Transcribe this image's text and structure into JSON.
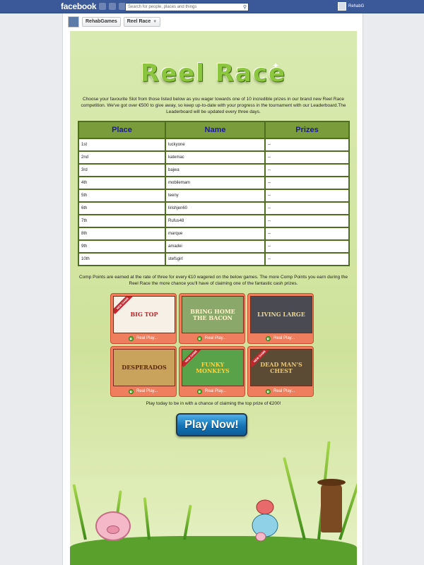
{
  "facebook": {
    "logo": "facebook",
    "search_placeholder": "Search for people, places and things",
    "user_name": "RehabG"
  },
  "breadcrumb": {
    "page": "RehabGames",
    "tab": "Reel Race"
  },
  "app": {
    "logo_text": "Reel Race",
    "intro": "Choose your favourite Slot from those listed below as you wager towards one of 10 incredible prizes in our brand new Reel Race competition. We've got over €500 to give away, so keep up-to-date with your progress in the tournament with our Leaderboard.The Leaderboard will be updated every three days.",
    "leaderboard": {
      "headers": [
        "Place",
        "Name",
        "Prizes"
      ],
      "rows": [
        [
          "1st",
          "luckyone",
          "--"
        ],
        [
          "2nd",
          "katemac",
          "--"
        ],
        [
          "3rd",
          "bajwa",
          "--"
        ],
        [
          "4th",
          "mobilemam",
          "--"
        ],
        [
          "5th",
          "teeny",
          "--"
        ],
        [
          "6th",
          "lirishjen60",
          "--"
        ],
        [
          "7th",
          "Rufus48",
          "--"
        ],
        [
          "8th",
          "marque",
          "--"
        ],
        [
          "9th",
          "amadei",
          "--"
        ],
        [
          "10th",
          "stefsgirl",
          "--"
        ]
      ]
    },
    "comp_points": "Comp Points are earned at the rate of three for every €10 wagered on the below games. The more Comp Points you earn during the Reel Race the more chance you'll have of claiming one of the fantastic cash prizes.",
    "games": [
      {
        "title": "BIG TOP",
        "new": true,
        "play_label": "Real Play...",
        "bg": "#f6f0e6",
        "fg": "#c0272d"
      },
      {
        "title": "BRING HOME THE BACON",
        "new": false,
        "play_label": "Real Play...",
        "bg": "#8aa86a",
        "fg": "#fff3c9"
      },
      {
        "title": "LIVING LARGE",
        "new": false,
        "play_label": "Real Play...",
        "bg": "#4a4a52",
        "fg": "#e8d79a"
      },
      {
        "title": "DESPERADOS",
        "new": false,
        "play_label": "Real Play...",
        "bg": "#c9a25c",
        "fg": "#5b2a0e"
      },
      {
        "title": "FUNKY MONKEYS",
        "new": true,
        "play_label": "Real Play...",
        "bg": "#5aa24a",
        "fg": "#ffd23a"
      },
      {
        "title": "DEAD MAN'S CHEST",
        "new": true,
        "play_label": "Real Play...",
        "bg": "#5b4b34",
        "fg": "#e8c67a"
      }
    ],
    "new_game_label": "NEW GAME",
    "cta_text": "Play today to be in with a chance of claiming the top prize of €200!",
    "play_button": "Play Now!"
  }
}
